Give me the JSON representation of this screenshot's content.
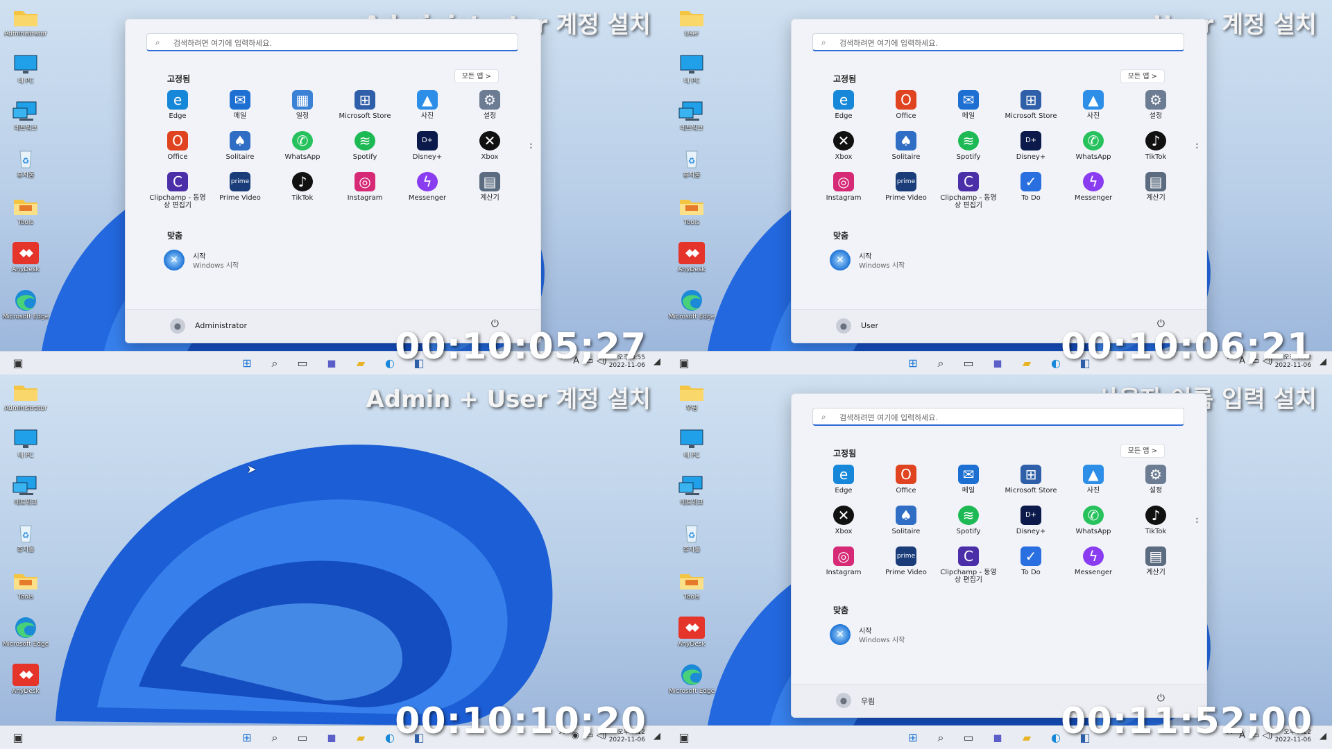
{
  "colors": {
    "accent": "#2d6ad6",
    "wallpaper": "#1e5fd8",
    "panel": "#f1f3f8"
  },
  "search_placeholder": "검색하려면 여기에 입력하세요.",
  "pinned_label": "고정됨",
  "all_apps_label": "모든 앱  >",
  "recommended_label": "맞춤",
  "rec_title": "시작",
  "rec_sub": "Windows 시작",
  "quads": [
    {
      "title": "Administrator 계정 설치",
      "timecode": "00:10:05;27",
      "user": "Administrator",
      "time": "오후 8:55",
      "date": "2022-11-06",
      "desktop": [
        "Administrator",
        "내 PC",
        "네트워크",
        "휴지통",
        "Tools",
        "AnyDesk",
        "Microsoft Edge"
      ],
      "apps": [
        "Edge",
        "메일",
        "일정",
        "Microsoft Store",
        "사진",
        "설정",
        "Office",
        "Solitaire",
        "WhatsApp",
        "Spotify",
        "Disney+",
        "Xbox",
        "Clipchamp - 동영상 편집기",
        "Prime Video",
        "TikTok",
        "Instagram",
        "Messenger",
        "계산기"
      ]
    },
    {
      "title": "User 계정 설치",
      "timecode": "00:10:06;21",
      "user": "User",
      "time": "오후 9:02",
      "date": "2022-11-06",
      "desktop": [
        "User",
        "내 PC",
        "네트워크",
        "휴지통",
        "Tools",
        "AnyDesk",
        "Microsoft Edge"
      ],
      "apps": [
        "Edge",
        "Office",
        "메일",
        "Microsoft Store",
        "사진",
        "설정",
        "Xbox",
        "Solitaire",
        "Spotify",
        "Disney+",
        "WhatsApp",
        "TikTok",
        "Instagram",
        "Prime Video",
        "Clipchamp - 동영상 편집기",
        "To Do",
        "Messenger",
        "계산기"
      ]
    },
    {
      "title": "Admin + User 계정 설치",
      "timecode": "00:10:10;20",
      "time": "오후 9:12",
      "date": "2022-11-06",
      "desktop": [
        "Administrator",
        "내 PC",
        "네트워크",
        "휴지통",
        "Tools",
        "Microsoft Edge",
        "AnyDesk"
      ]
    },
    {
      "title": "사용자 이름 입력 설치",
      "timecode": "00:11:52;00",
      "user": "우림",
      "time": "오후 9:22",
      "date": "2022-11-06",
      "desktop": [
        "우림",
        "내 PC",
        "네트워크",
        "휴지통",
        "Tools",
        "AnyDesk",
        "Microsoft Edge"
      ],
      "apps": [
        "Edge",
        "Office",
        "메일",
        "Microsoft Store",
        "사진",
        "설정",
        "Xbox",
        "Solitaire",
        "Spotify",
        "Disney+",
        "WhatsApp",
        "TikTok",
        "Instagram",
        "Prime Video",
        "Clipchamp - 동영상 편집기",
        "To Do",
        "Messenger",
        "계산기"
      ]
    }
  ]
}
